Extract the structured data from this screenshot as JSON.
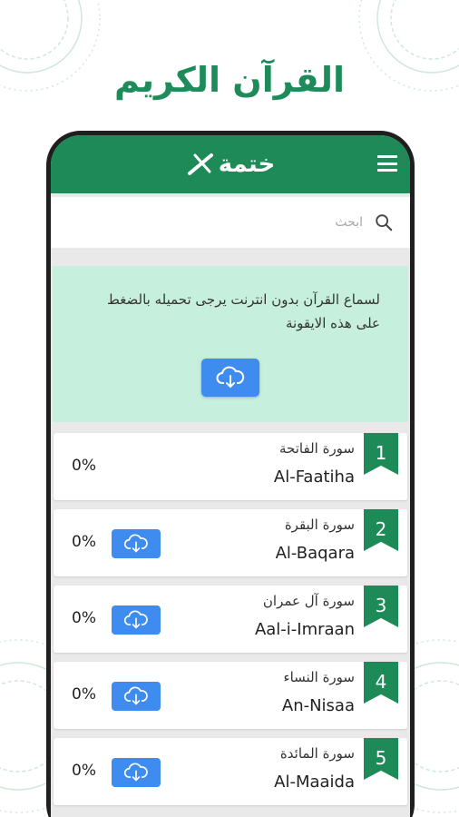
{
  "heading": "القرآن الكريم",
  "app": {
    "logo_text": "ختمة"
  },
  "search": {
    "placeholder": "ابحث"
  },
  "notice": {
    "text": "لسماع القرآن بدون انترنت يرجى تحميله بالضغط على هذه الايقونة"
  },
  "surahs": [
    {
      "number": "1",
      "arabic": "سورة الفاتحة",
      "english": "Al-Faatiha",
      "progress": "0%",
      "download": false
    },
    {
      "number": "2",
      "arabic": "سورة البقرة",
      "english": "Al-Baqara",
      "progress": "0%",
      "download": true
    },
    {
      "number": "3",
      "arabic": "سورة آل عمران",
      "english": "Aal-i-Imraan",
      "progress": "0%",
      "download": true
    },
    {
      "number": "4",
      "arabic": "سورة النساء",
      "english": "An-Nisaa",
      "progress": "0%",
      "download": true
    },
    {
      "number": "5",
      "arabic": "سورة المائدة",
      "english": "Al-Maaida",
      "progress": "0%",
      "download": true
    }
  ],
  "colors": {
    "brand_green": "#1d8a58",
    "notice_bg": "#c6f0dd",
    "download_blue": "#3f8cf0"
  }
}
